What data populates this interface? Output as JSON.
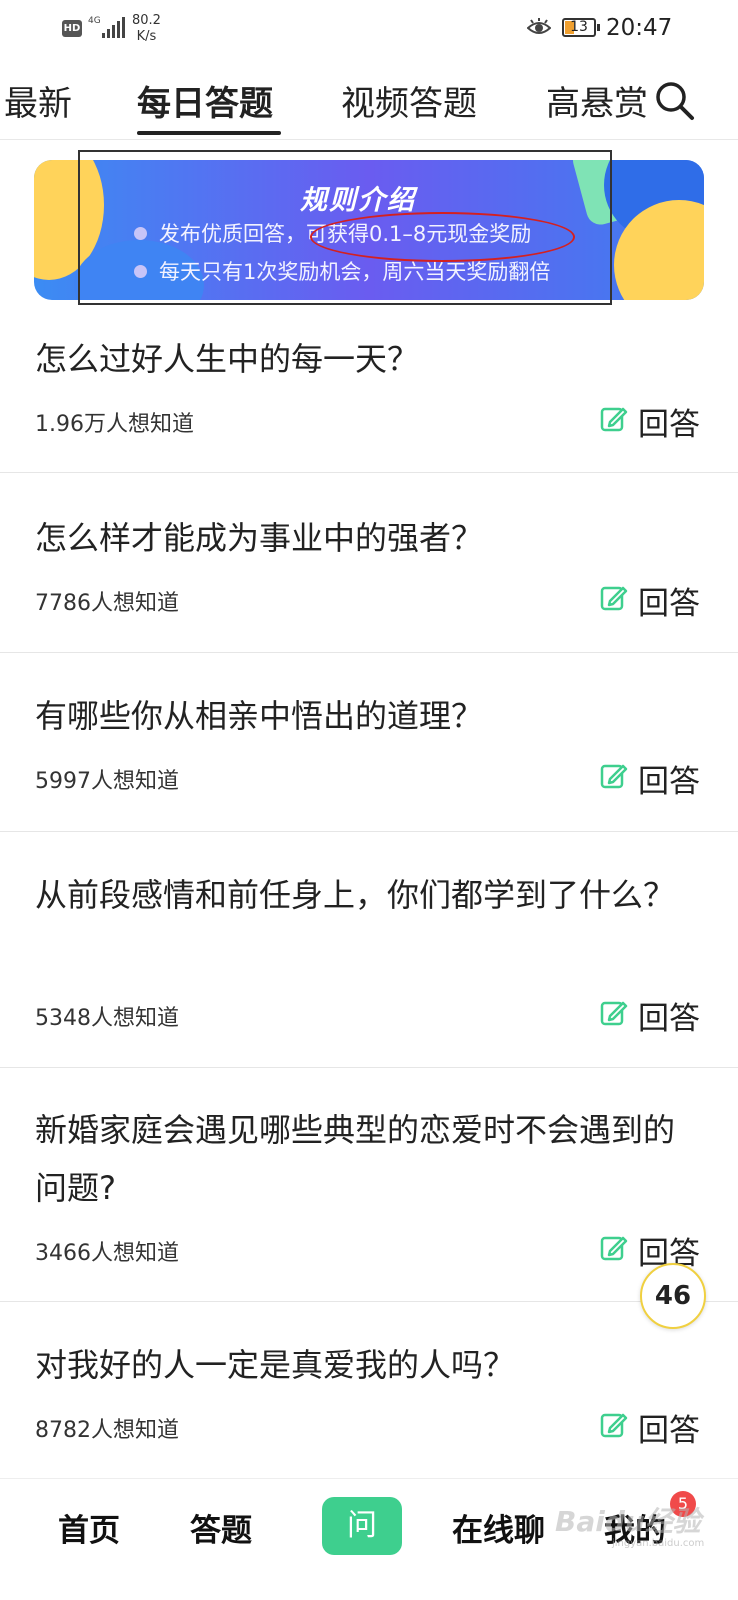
{
  "status_bar": {
    "hd": "HD",
    "network": "4G",
    "speed_value": "80.2",
    "speed_unit": "K/s",
    "battery": "13",
    "time": "20:47"
  },
  "tabs": [
    {
      "label": "最新",
      "active": false
    },
    {
      "label": "每日答题",
      "active": true
    },
    {
      "label": "视频答题",
      "active": false
    },
    {
      "label": "高悬赏",
      "active": false
    }
  ],
  "banner": {
    "title": "规则介绍",
    "line1": "发布优质回答，可获得0.1–8元现金奖励",
    "line2": "每天只有1次奖励机会，周六当天奖励翻倍"
  },
  "questions": [
    {
      "title": "怎么过好人生中的每一天？",
      "count": "1.96万人想知道",
      "action": "回答"
    },
    {
      "title": "怎么样才能成为事业中的强者？",
      "count": "7786人想知道",
      "action": "回答"
    },
    {
      "title": "有哪些你从相亲中悟出的道理？",
      "count": "5997人想知道",
      "action": "回答"
    },
    {
      "title": "从前段感情和前任身上，你们都学到了什么？",
      "count": "5348人想知道",
      "action": "回答"
    },
    {
      "title": "新婚家庭会遇见哪些典型的恋爱时不会遇到的问题?",
      "count": "3466人想知道",
      "action": "回答"
    },
    {
      "title": "对我好的人一定是真爱我的人吗？",
      "count": "8782人想知道",
      "action": "回答"
    }
  ],
  "float_badge": "46",
  "bottom_nav": {
    "home": "首页",
    "answer": "答题",
    "ask": "问",
    "chat": "在线聊",
    "mine": "我的",
    "mine_badge": "5"
  },
  "watermark": {
    "text": "Baidu经验",
    "sub": "jingyan.baidu.com"
  },
  "colors": {
    "accent_green": "#3ecf8e",
    "banner_blue": "#3b8cf3",
    "banner_purple": "#6a5cf0",
    "annotation_red": "#d42020",
    "badge_red": "#f04a4a"
  }
}
